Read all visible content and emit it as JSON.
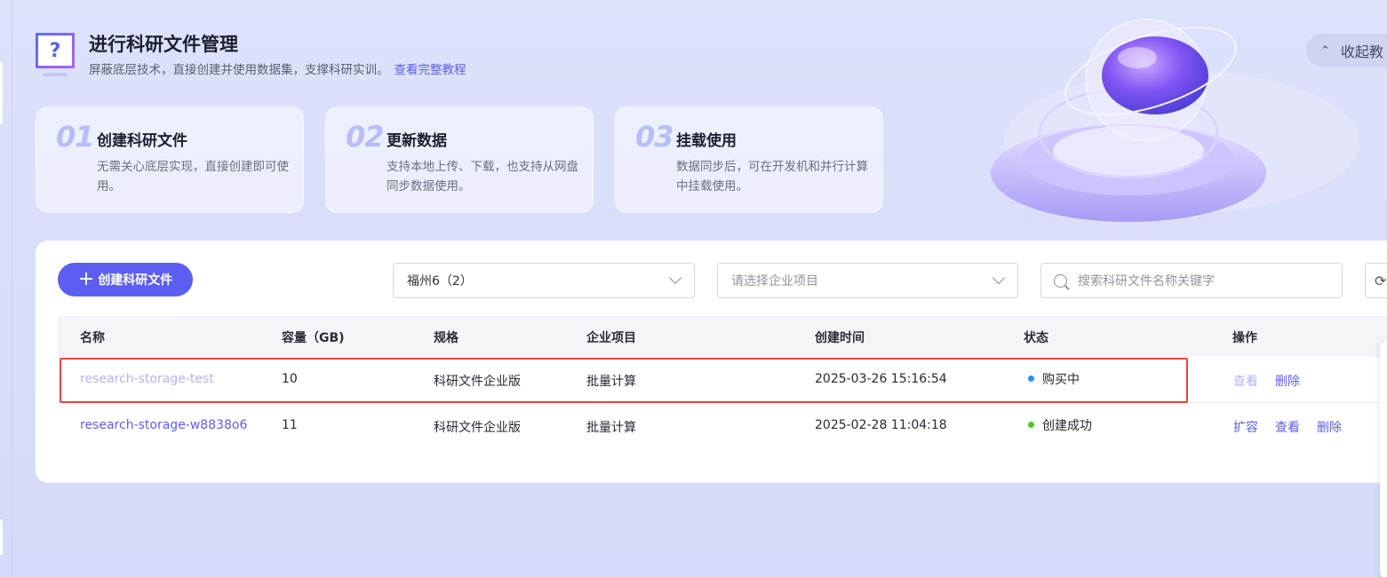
{
  "header": {
    "title": "进行科研文件管理",
    "subtitle": "屏蔽底层技术，直接创建并使用数据集，支撑科研实训。",
    "tutorial_link": "查看完整教程",
    "collapse_label": "收起教",
    "help_icon": "question-icon"
  },
  "steps": [
    {
      "num": "01",
      "title": "创建科研文件",
      "desc": "无需关心底层实现，直接创建即可使用。"
    },
    {
      "num": "02",
      "title": "更新数据",
      "desc": "支持本地上传、下载，也支持从网盘同步数据使用。"
    },
    {
      "num": "03",
      "title": "挂载使用",
      "desc": "数据同步后，可在开发机和并行计算中挂载使用。"
    }
  ],
  "toolbar": {
    "create_label": "创建科研文件",
    "region_value": "福州6（2）",
    "project_placeholder": "请选择企业项目",
    "search_placeholder": "搜索科研文件名称关键字"
  },
  "table": {
    "columns": [
      "名称",
      "容量（GB)",
      "规格",
      "企业项目",
      "创建时间",
      "状态",
      "操作"
    ],
    "rows": [
      {
        "name": "research-storage-test",
        "capacity": "10",
        "spec": "科研文件企业版",
        "project": "批量计算",
        "created": "2025-03-26 15:16:54",
        "status": "购买中",
        "status_color": "#2f8ef3",
        "actions": [
          "查看",
          "删除"
        ]
      },
      {
        "name": "research-storage-w8838o6",
        "capacity": "11",
        "spec": "科研文件企业版",
        "project": "批量计算",
        "created": "2025-02-28 11:04:18",
        "status": "创建成功",
        "status_color": "#52c41a",
        "actions": [
          "扩容",
          "查看",
          "删除"
        ]
      }
    ]
  },
  "colors": {
    "accent": "#5c5ef2",
    "highlight_border": "#e0473c"
  }
}
